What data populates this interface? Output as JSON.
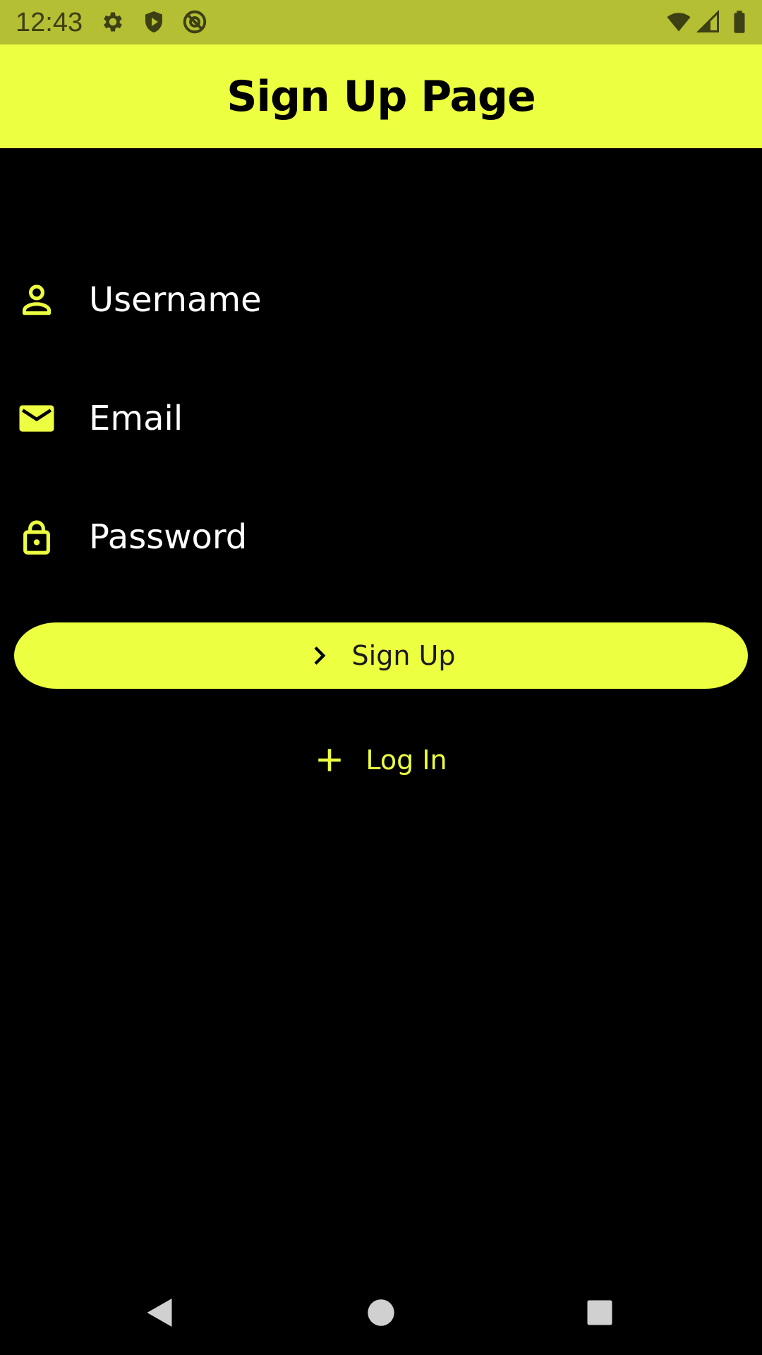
{
  "status_bar": {
    "time": "12:43",
    "icons": [
      "settings-icon",
      "shield-play-icon",
      "at-sign-icon",
      "wifi-icon",
      "cell-signal-icon",
      "battery-icon"
    ]
  },
  "app_bar": {
    "title": "Sign Up Page"
  },
  "form": {
    "username": {
      "placeholder": "Username",
      "value": "",
      "icon": "person-icon"
    },
    "email": {
      "placeholder": "Email",
      "value": "",
      "icon": "mail-icon"
    },
    "password": {
      "placeholder": "Password",
      "value": "",
      "icon": "lock-icon"
    }
  },
  "actions": {
    "signup_label": "Sign Up",
    "signup_icon": "chevron-right-icon",
    "login_label": "Log In",
    "login_icon": "plus-icon"
  },
  "nav_bar": {
    "buttons": [
      "back-icon",
      "home-icon",
      "recents-icon"
    ]
  },
  "colors": {
    "accent": "#ecff40",
    "status_bar": "#b4bf33",
    "background": "#000000",
    "text": "#ffffff"
  }
}
